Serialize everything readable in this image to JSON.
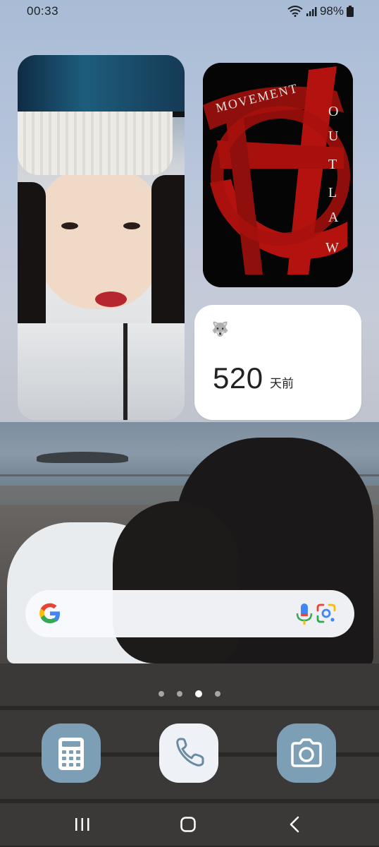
{
  "status_bar": {
    "time": "00:33",
    "battery_percent": "98%",
    "icons": [
      "wifi-icon",
      "signal-icon",
      "battery-icon"
    ]
  },
  "widgets": {
    "photo": {
      "description_icon": "photo-widget-image"
    },
    "album_art": {
      "text_arc": "MOVEMENT",
      "text_vertical": [
        "O",
        "U",
        "T",
        "L",
        "A",
        "W"
      ],
      "colors": {
        "background": "#050505",
        "mark": "#b3120f",
        "text": "#e9e2dd"
      }
    },
    "dday": {
      "emoji": "🐺",
      "count": "520",
      "unit": "天前"
    }
  },
  "search_bar": {
    "icons": [
      "google-g-icon",
      "mic-icon",
      "google-lens-icon"
    ]
  },
  "page_indicator": {
    "pages": 4,
    "active_index": 2
  },
  "dock": {
    "apps": [
      {
        "name": "calculator",
        "icon": "calculator-icon"
      },
      {
        "name": "phone",
        "icon": "phone-icon"
      },
      {
        "name": "camera",
        "icon": "camera-icon"
      }
    ]
  },
  "nav_bar": {
    "buttons": [
      "recent-apps-icon",
      "home-icon",
      "back-icon"
    ]
  },
  "colors": {
    "dock_tile": "#7d9fb5",
    "phone_tile": "#eef2f7",
    "widget_bg": "#ffffff"
  }
}
